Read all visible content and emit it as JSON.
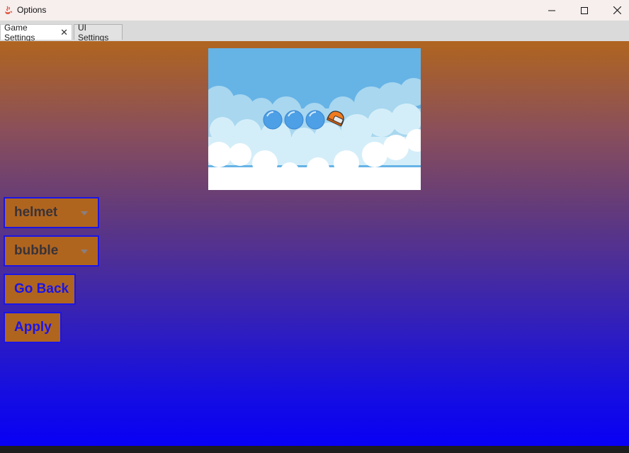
{
  "window": {
    "title": "Options",
    "icon": "java-coffee-cup-icon",
    "controls": [
      "minimize-icon",
      "maximize-icon",
      "close-icon"
    ]
  },
  "tabs": [
    {
      "label": "Game Settings",
      "selected": true,
      "closable": true
    },
    {
      "label": "UI Settings",
      "selected": false,
      "closable": false
    }
  ],
  "preview": {
    "description_icons": [
      "bubble",
      "bubble",
      "bubble",
      "helmet"
    ]
  },
  "controls": {
    "helmet_select": {
      "value": "helmet"
    },
    "bubble_select": {
      "value": "bubble"
    },
    "go_back_label": "Go Back",
    "apply_label": "Apply"
  },
  "colors": {
    "control_bg": "#b0651f",
    "control_border": "#1b15e6",
    "gradient_top": "#b0651f",
    "gradient_bottom": "#0800f5"
  }
}
